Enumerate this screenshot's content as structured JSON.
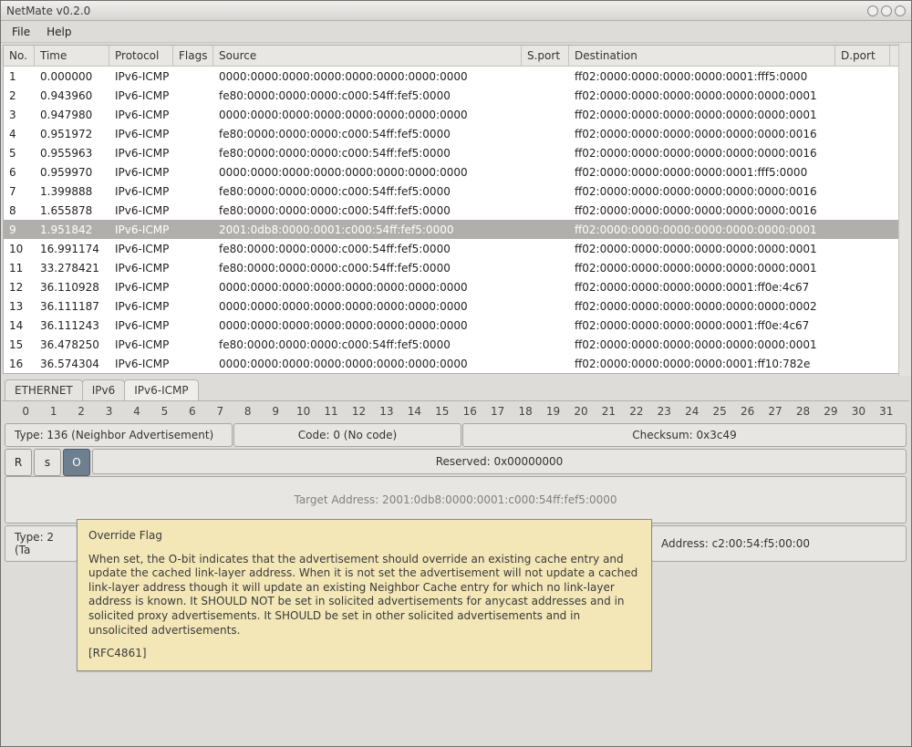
{
  "window": {
    "title": "NetMate v0.2.0"
  },
  "menu": {
    "file": "File",
    "help": "Help"
  },
  "columns": {
    "no": "No.",
    "time": "Time",
    "protocol": "Protocol",
    "flags": "Flags",
    "source": "Source",
    "sport": "S.port",
    "destination": "Destination",
    "dport": "D.port"
  },
  "packets": [
    {
      "no": "1",
      "time": "0.000000",
      "proto": "IPv6-ICMP",
      "flags": "",
      "src": "0000:0000:0000:0000:0000:0000:0000:0000",
      "sport": "",
      "dest": "ff02:0000:0000:0000:0000:0001:fff5:0000",
      "dport": "",
      "selected": false
    },
    {
      "no": "2",
      "time": "0.943960",
      "proto": "IPv6-ICMP",
      "flags": "",
      "src": "fe80:0000:0000:0000:c000:54ff:fef5:0000",
      "sport": "",
      "dest": "ff02:0000:0000:0000:0000:0000:0000:0001",
      "dport": "",
      "selected": false
    },
    {
      "no": "3",
      "time": "0.947980",
      "proto": "IPv6-ICMP",
      "flags": "",
      "src": "0000:0000:0000:0000:0000:0000:0000:0000",
      "sport": "",
      "dest": "ff02:0000:0000:0000:0000:0000:0000:0001",
      "dport": "",
      "selected": false
    },
    {
      "no": "4",
      "time": "0.951972",
      "proto": "IPv6-ICMP",
      "flags": "",
      "src": "fe80:0000:0000:0000:c000:54ff:fef5:0000",
      "sport": "",
      "dest": "ff02:0000:0000:0000:0000:0000:0000:0016",
      "dport": "",
      "selected": false
    },
    {
      "no": "5",
      "time": "0.955963",
      "proto": "IPv6-ICMP",
      "flags": "",
      "src": "fe80:0000:0000:0000:c000:54ff:fef5:0000",
      "sport": "",
      "dest": "ff02:0000:0000:0000:0000:0000:0000:0016",
      "dport": "",
      "selected": false
    },
    {
      "no": "6",
      "time": "0.959970",
      "proto": "IPv6-ICMP",
      "flags": "",
      "src": "0000:0000:0000:0000:0000:0000:0000:0000",
      "sport": "",
      "dest": "ff02:0000:0000:0000:0000:0001:fff5:0000",
      "dport": "",
      "selected": false
    },
    {
      "no": "7",
      "time": "1.399888",
      "proto": "IPv6-ICMP",
      "flags": "",
      "src": "fe80:0000:0000:0000:c000:54ff:fef5:0000",
      "sport": "",
      "dest": "ff02:0000:0000:0000:0000:0000:0000:0016",
      "dport": "",
      "selected": false
    },
    {
      "no": "8",
      "time": "1.655878",
      "proto": "IPv6-ICMP",
      "flags": "",
      "src": "fe80:0000:0000:0000:c000:54ff:fef5:0000",
      "sport": "",
      "dest": "ff02:0000:0000:0000:0000:0000:0000:0016",
      "dport": "",
      "selected": false
    },
    {
      "no": "9",
      "time": "1.951842",
      "proto": "IPv6-ICMP",
      "flags": "",
      "src": "2001:0db8:0000:0001:c000:54ff:fef5:0000",
      "sport": "",
      "dest": "ff02:0000:0000:0000:0000:0000:0000:0001",
      "dport": "",
      "selected": true
    },
    {
      "no": "10",
      "time": "16.991174",
      "proto": "IPv6-ICMP",
      "flags": "",
      "src": "fe80:0000:0000:0000:c000:54ff:fef5:0000",
      "sport": "",
      "dest": "ff02:0000:0000:0000:0000:0000:0000:0001",
      "dport": "",
      "selected": false
    },
    {
      "no": "11",
      "time": "33.278421",
      "proto": "IPv6-ICMP",
      "flags": "",
      "src": "fe80:0000:0000:0000:c000:54ff:fef5:0000",
      "sport": "",
      "dest": "ff02:0000:0000:0000:0000:0000:0000:0001",
      "dport": "",
      "selected": false
    },
    {
      "no": "12",
      "time": "36.110928",
      "proto": "IPv6-ICMP",
      "flags": "",
      "src": "0000:0000:0000:0000:0000:0000:0000:0000",
      "sport": "",
      "dest": "ff02:0000:0000:0000:0000:0001:ff0e:4c67",
      "dport": "",
      "selected": false
    },
    {
      "no": "13",
      "time": "36.111187",
      "proto": "IPv6-ICMP",
      "flags": "",
      "src": "0000:0000:0000:0000:0000:0000:0000:0000",
      "sport": "",
      "dest": "ff02:0000:0000:0000:0000:0000:0000:0002",
      "dport": "",
      "selected": false
    },
    {
      "no": "14",
      "time": "36.111243",
      "proto": "IPv6-ICMP",
      "flags": "",
      "src": "0000:0000:0000:0000:0000:0000:0000:0000",
      "sport": "",
      "dest": "ff02:0000:0000:0000:0000:0001:ff0e:4c67",
      "dport": "",
      "selected": false
    },
    {
      "no": "15",
      "time": "36.478250",
      "proto": "IPv6-ICMP",
      "flags": "",
      "src": "fe80:0000:0000:0000:c000:54ff:fef5:0000",
      "sport": "",
      "dest": "ff02:0000:0000:0000:0000:0000:0000:0001",
      "dport": "",
      "selected": false
    },
    {
      "no": "16",
      "time": "36.574304",
      "proto": "IPv6-ICMP",
      "flags": "",
      "src": "0000:0000:0000:0000:0000:0000:0000:0000",
      "sport": "",
      "dest": "ff02:0000:0000:0000:0000:0001:ff10:782e",
      "dport": "",
      "selected": false
    }
  ],
  "tabs": {
    "eth": "ETHERNET",
    "ipv6": "IPv6",
    "icmp": "IPv6-ICMP",
    "active": "icmp"
  },
  "bits": [
    "0",
    "1",
    "2",
    "3",
    "4",
    "5",
    "6",
    "7",
    "8",
    "9",
    "10",
    "11",
    "12",
    "13",
    "14",
    "15",
    "16",
    "17",
    "18",
    "19",
    "20",
    "21",
    "22",
    "23",
    "24",
    "25",
    "26",
    "27",
    "28",
    "29",
    "30",
    "31"
  ],
  "detail": {
    "type": "Type: 136 (Neighbor Advertisement)",
    "code": "Code: 0 (No code)",
    "checksum": "Checksum: 0x3c49",
    "flags": {
      "r": "R",
      "s": "s",
      "o": "O"
    },
    "reserved": "Reserved: 0x00000000",
    "target": "Target Address: 2001:0db8:0000:0001:c000:54ff:fef5:0000",
    "opt_type_left": "Type: 2 (Ta",
    "opt_addr_right": "Address: c2:00:54:f5:00:00"
  },
  "tooltip": {
    "title": "Override Flag",
    "body": "When set, the O-bit indicates that the advertisement should override an existing cache entry and update the cached link-layer address. When it is not set the advertisement will not update a cached link-layer address though it will update an existing Neighbor Cache entry for which no link-layer address is known.  It SHOULD NOT be set in solicited advertisements for anycast addresses and in solicited proxy advertisements. It SHOULD be set in other solicited advertisements and in unsolicited advertisements.",
    "ref": "[RFC4861]"
  }
}
